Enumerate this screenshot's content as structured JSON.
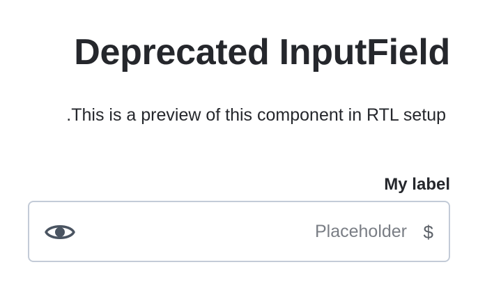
{
  "page": {
    "title": "Deprecated InputField",
    "description": ".This is a preview of this component in RTL setup"
  },
  "input_field": {
    "label": "My label",
    "value": "",
    "placeholder": "Placeholder",
    "prefix": "$",
    "icon": "eye-icon"
  },
  "colors": {
    "text": "#25272c",
    "border": "#c3cbd7",
    "icon": "#4a5461",
    "placeholder": "#7a7e85"
  }
}
